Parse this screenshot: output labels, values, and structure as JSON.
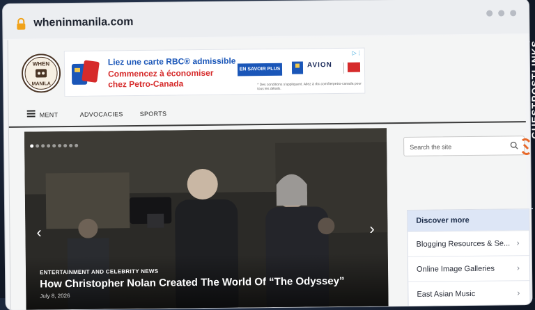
{
  "browser": {
    "url": "wheninmanila.com"
  },
  "site": {
    "logo_text_top": "WHEN",
    "logo_text_bottom": "MANILA"
  },
  "ad": {
    "line1": "Liez une carte RBC® admissible",
    "line2": "Commencez à économiser",
    "line3": "chez Petro-Canada",
    "button": "EN SAVOIR PLUS",
    "brand": "AVION",
    "fine_print": "* Des conditions s'appliquent. Allez à rbc.com/lierpetro-canada pour tous les détails."
  },
  "nav": {
    "items": [
      "MENT",
      "ADVOCACIES",
      "SPORTS"
    ]
  },
  "hero": {
    "category": "ENTERTAINMENT AND CELEBRITY NEWS",
    "title": "How Christopher Nolan Created The World Of “The Odyssey”",
    "date": "July 8, 2026",
    "slide_count": 9,
    "active_slide": 0
  },
  "search": {
    "placeholder": "Search the site"
  },
  "discover": {
    "title": "Discover more",
    "items": [
      "Blogging Resources & Se...",
      "Online Image Galleries",
      "East Asian Music"
    ]
  },
  "watermark": {
    "text": "GUESTPOSTLINKS"
  },
  "colors": {
    "accent": "#1a56b8",
    "ad_red": "#d62b2b",
    "discover_head": "#dde6f6"
  }
}
